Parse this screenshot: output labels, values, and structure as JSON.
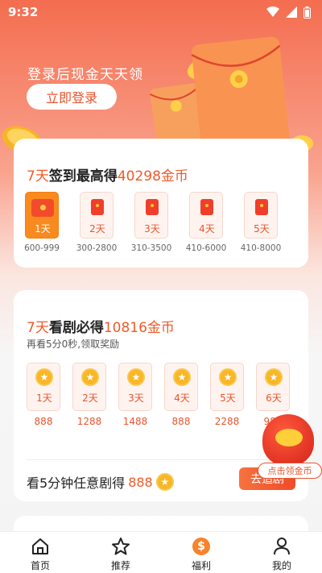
{
  "status_bar": {
    "time": "9:32"
  },
  "hero": {
    "text": "登录后现金天天领",
    "login_button": "立即登录"
  },
  "signin_card": {
    "title_prefix": "7天",
    "title_main": "签到最高得",
    "title_amount": "40298",
    "title_unit": "金币",
    "days": [
      {
        "day": "1天",
        "range": "600-999",
        "active": true
      },
      {
        "day": "2天",
        "range": "300-2800",
        "active": false
      },
      {
        "day": "3天",
        "range": "310-3500",
        "active": false
      },
      {
        "day": "4天",
        "range": "410-6000",
        "active": false
      },
      {
        "day": "5天",
        "range": "410-8000",
        "active": false
      }
    ]
  },
  "watch_card": {
    "title_prefix": "7天",
    "title_main": "看剧必得",
    "title_amount": "10816",
    "title_unit": "金币",
    "subtitle": "再看5分0秒,领取奖励",
    "days": [
      {
        "day": "1天",
        "coins": "888"
      },
      {
        "day": "2天",
        "coins": "1288"
      },
      {
        "day": "3天",
        "coins": "1488"
      },
      {
        "day": "4天",
        "coins": "888"
      },
      {
        "day": "5天",
        "coins": "2288"
      },
      {
        "day": "6天",
        "coins": "988"
      }
    ],
    "task_text": "看5分钟任意剧得",
    "task_amount": "888",
    "go_button": "去追剧"
  },
  "float_widget": {
    "label": "点击领金币"
  },
  "bottom_nav": {
    "items": [
      {
        "label": "首页",
        "icon": "home-icon"
      },
      {
        "label": "推荐",
        "icon": "star-icon"
      },
      {
        "label": "福利",
        "icon": "dollar-icon"
      },
      {
        "label": "我的",
        "icon": "person-icon"
      }
    ]
  },
  "colors": {
    "accent": "#f05a28",
    "gold": "#f9b626",
    "hero_top": "#f46d4f"
  }
}
